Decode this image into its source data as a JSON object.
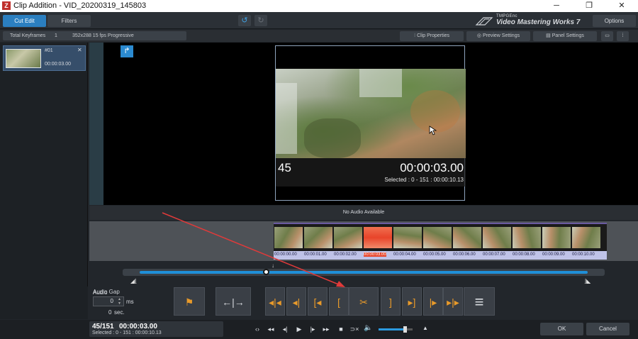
{
  "window": {
    "title": "Clip Addition - VID_20200319_145803",
    "minimize": "─",
    "maximize": "❐",
    "close": "✕",
    "app_icon": "Z"
  },
  "tabs": [
    {
      "label": "Cut Edit",
      "active": true
    },
    {
      "label": "Filters",
      "active": false
    }
  ],
  "toolbar": {
    "undo_icon": "undo-icon",
    "redo_icon": "redo-icon"
  },
  "brand": {
    "small": "TMPGEnc",
    "large": "Video Mastering Works 7"
  },
  "options_label": "Options",
  "info": {
    "keyframes_label": "Total Keyframes",
    "keyframes_value": "1",
    "format": "352x288 15 fps Progressive"
  },
  "panel_buttons": {
    "clip_properties": "Clip Properties",
    "preview_settings": "Preview Settings",
    "panel_settings": "Panel Settings"
  },
  "clip": {
    "name": "#01",
    "duration": "00:00:03.00",
    "close": "✕"
  },
  "viewer": {
    "frame": "45",
    "timecode": "00:00:03.00",
    "selected": "Selected : 0 - 151 : 00:00:10.13",
    "marker": "↱"
  },
  "audio": {
    "status": "No Audio Available"
  },
  "timeline": {
    "timecodes": [
      "00:00:00.00",
      "00:00:01.00",
      "00:00:02.00",
      "00:00:03.00",
      "00:00:04.00",
      "00:00:05.00",
      "00:00:06.00",
      "00:00:07.00",
      "00:00:08.00",
      "00:00:09.00",
      "00:00:10.00"
    ],
    "current_index": 3
  },
  "scrub": {
    "position": 0.298,
    "start_marker": "◢⌊",
    "end_marker": "⌋◣"
  },
  "audio_gap": {
    "label": "Audio Gap",
    "value": "0",
    "unit_ms": "ms",
    "sec_value": "0",
    "unit_sec": "sec."
  },
  "controls": [
    {
      "name": "chapter-flag-button",
      "glyph": "⚑"
    },
    {
      "name": "split-button",
      "glyph": "←|→"
    },
    {
      "name": "prev-cut-button",
      "glyph": "◂|◂"
    },
    {
      "name": "prev-frame-button",
      "glyph": "◂|"
    },
    {
      "name": "go-start-button",
      "glyph": "[◂"
    },
    {
      "name": "set-start-button",
      "glyph": "["
    },
    {
      "name": "cut-button",
      "glyph": "✂"
    },
    {
      "name": "set-end-button",
      "glyph": "]"
    },
    {
      "name": "go-end-button",
      "glyph": "▸]"
    },
    {
      "name": "next-frame-button",
      "glyph": "|▸"
    },
    {
      "name": "next-cut-button",
      "glyph": "▸|▸"
    },
    {
      "name": "menu-button",
      "glyph": "≡"
    }
  ],
  "status": {
    "frame": "45/151",
    "time": "00:00:03.00",
    "selected": "Selected : 0 - 151 : 00:00:10.13"
  },
  "playback": [
    "‹›",
    "◂◂",
    "◂|",
    "▶",
    "|▸",
    "▸▸",
    "■",
    "⊃×"
  ],
  "volume": {
    "icon": "🔈",
    "level": 0.78,
    "up": "▲"
  },
  "dialog": {
    "ok": "OK",
    "cancel": "Cancel"
  },
  "colors": {
    "accent": "#2b7fc0",
    "orange": "#e89a2a",
    "selected_frame": "#e8442a",
    "annotation_arrow": "#e03a3a"
  }
}
